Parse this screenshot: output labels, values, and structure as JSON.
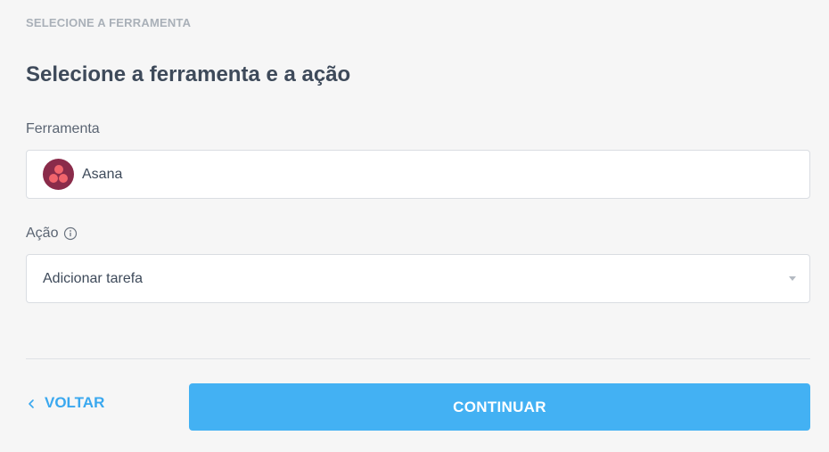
{
  "step": {
    "eyebrow": "SELECIONE A FERRAMENTA",
    "title": "Selecione a ferramenta e a ação"
  },
  "tool_field": {
    "label": "Ferramenta",
    "value": "Asana",
    "icon": "asana-logo-icon",
    "logo_color": "#8a2b4a",
    "logo_dots_color": "#f1646c"
  },
  "action_field": {
    "label": "Ação",
    "info_icon": "info-icon",
    "value": "Adicionar tarefa",
    "dropdown_icon": "chevron-down-icon"
  },
  "footer": {
    "back_label": "VOLTAR",
    "back_icon": "chevron-left-icon",
    "continue_label": "CONTINUAR",
    "accent_color": "#43b1f3"
  }
}
